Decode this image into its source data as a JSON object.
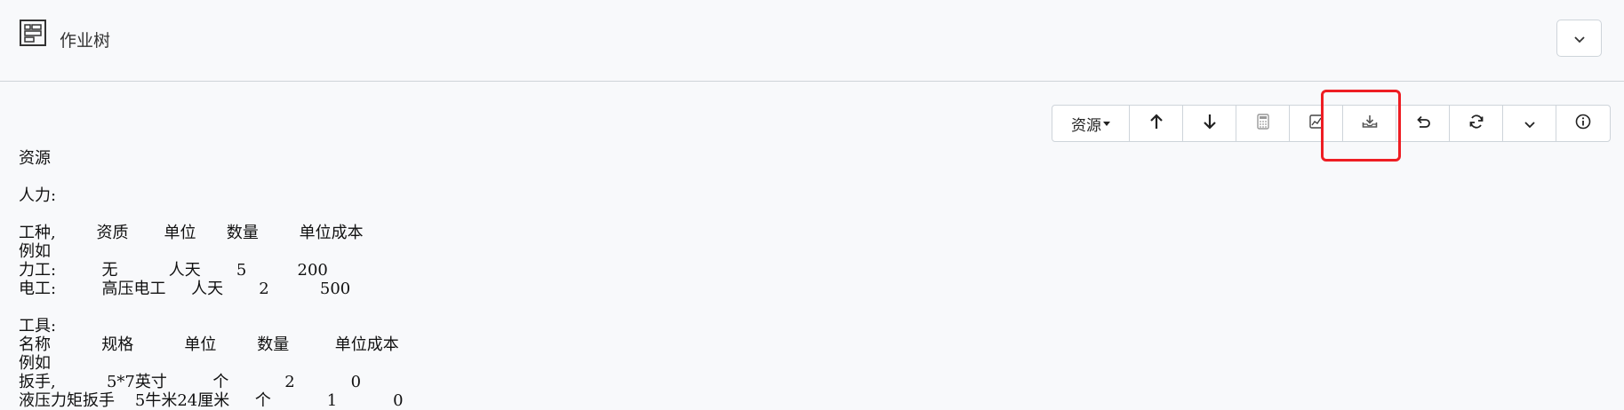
{
  "header": {
    "title": "作业树",
    "app_icon": "grid-app-icon",
    "collapse_icon": "chevron-down-icon"
  },
  "toolbar": {
    "resource_label": "资源",
    "buttons": [
      {
        "name": "move-up-button",
        "icon": "arrow-up-icon"
      },
      {
        "name": "move-down-button",
        "icon": "arrow-down-icon"
      },
      {
        "name": "calculator-button",
        "icon": "calculator-icon"
      },
      {
        "name": "chart-button",
        "icon": "chart-icon"
      },
      {
        "name": "download-button",
        "icon": "download-icon"
      },
      {
        "name": "undo-button",
        "icon": "undo-icon"
      },
      {
        "name": "refresh-button",
        "icon": "refresh-icon"
      },
      {
        "name": "more-button",
        "icon": "chevron-down-icon"
      },
      {
        "name": "info-button",
        "icon": "info-icon"
      }
    ],
    "highlight_color": "#ee1d23"
  },
  "content": {
    "lines": [
      "资源",
      "",
      "人力:",
      "",
      "工种,        资质       单位      数量        单位成本",
      "例如",
      "力工:         无          人天       5          200",
      "电工:         高压电工     人天       2          500",
      "",
      "工具:",
      "名称          规格          单位        数量         单位成本",
      "例如",
      "扳手,          5*7英寸         个           2           0",
      "液压力矩扳手    5牛米24厘米     个           1           0"
    ]
  }
}
